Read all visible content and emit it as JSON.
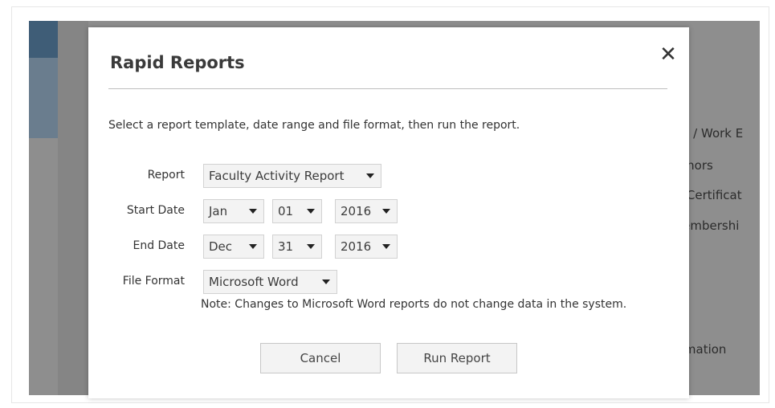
{
  "background": {
    "links": [
      "ic / Work E",
      "onors",
      "l Certificat",
      "lembershi",
      "rmation"
    ]
  },
  "dialog": {
    "title": "Rapid Reports",
    "close_icon": "close-icon",
    "description": "Select a report template, date range and file format, then run the report.",
    "report": {
      "label": "Report",
      "value": "Faculty Activity Report"
    },
    "start_date": {
      "label": "Start Date",
      "month": "Jan",
      "day": "01",
      "year": "2016"
    },
    "end_date": {
      "label": "End Date",
      "month": "Dec",
      "day": "31",
      "year": "2016"
    },
    "file_format": {
      "label": "File Format",
      "value": "Microsoft Word"
    },
    "note": "Note: Changes to Microsoft Word reports do not change data in the system.",
    "buttons": {
      "cancel": "Cancel",
      "run": "Run Report"
    }
  }
}
